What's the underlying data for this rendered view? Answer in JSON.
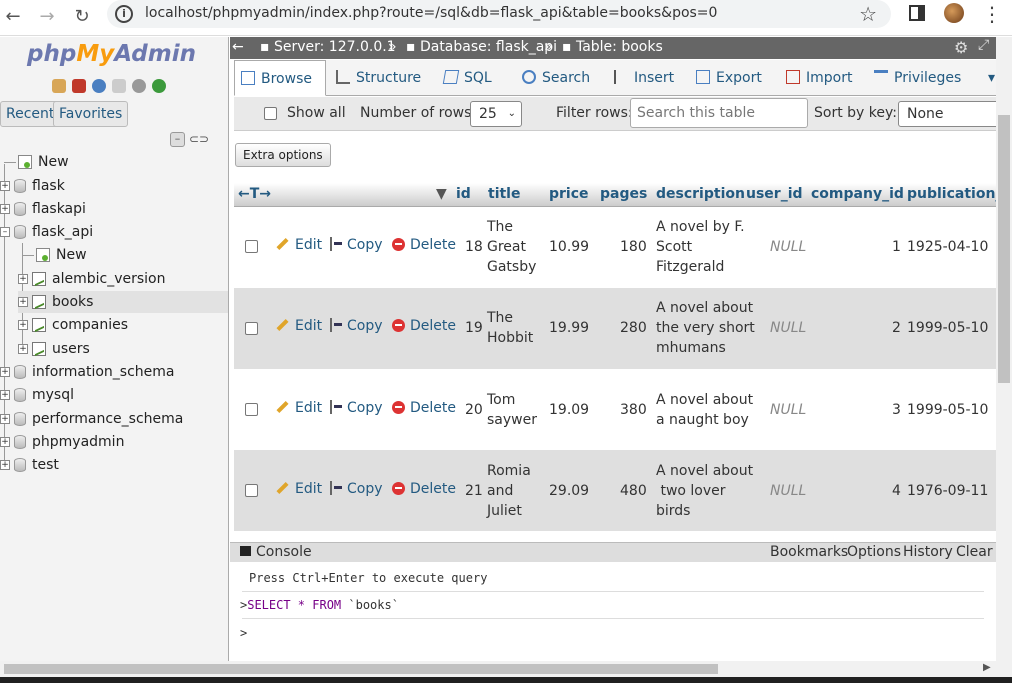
{
  "browser": {
    "url": "localhost/phpmyadmin/index.php?route=/sql&db=flask_api&table=books&pos=0",
    "back": "←",
    "forward": "→",
    "reload": "↻",
    "star": "☆",
    "menu": "⋮"
  },
  "sidebar": {
    "logo": {
      "php": "php",
      "my": "My",
      "admin": "Admin"
    },
    "tabs": {
      "recent": "Recent",
      "favorites": "Favorites"
    },
    "tree": [
      {
        "label": "New"
      },
      {
        "label": "flask"
      },
      {
        "label": "flaskapi"
      },
      {
        "label": "flask_api"
      },
      {
        "label": "New"
      },
      {
        "label": "alembic_version"
      },
      {
        "label": "books"
      },
      {
        "label": "companies"
      },
      {
        "label": "users"
      },
      {
        "label": "information_schema"
      },
      {
        "label": "mysql"
      },
      {
        "label": "performance_schema"
      },
      {
        "label": "phpmyadmin"
      },
      {
        "label": "test"
      }
    ]
  },
  "breadcrumb": {
    "server": "Server: 127.0.0.1",
    "database": "Database: flask_api",
    "table": "Table: books",
    "sep": "»"
  },
  "tabs": [
    {
      "label": "Browse"
    },
    {
      "label": "Structure"
    },
    {
      "label": "SQL"
    },
    {
      "label": "Search"
    },
    {
      "label": "Insert"
    },
    {
      "label": "Export"
    },
    {
      "label": "Import"
    },
    {
      "label": "Privileges"
    }
  ],
  "controls": {
    "show_all": "Show all",
    "rows_label": "Number of rows:",
    "rows_value": "25",
    "filter_label": "Filter rows:",
    "filter_placeholder": "Search this table",
    "sort_label": "Sort by key:",
    "sort_value": "None",
    "extra_options": "Extra options"
  },
  "columns": [
    "id",
    "title",
    "price",
    "pages",
    "description",
    "user_id",
    "company_id",
    "publication_da"
  ],
  "actions": {
    "edit": "Edit",
    "copy": "Copy",
    "delete": "Delete"
  },
  "rows": [
    {
      "id": "18",
      "title": [
        "The",
        "Great",
        "Gatsby"
      ],
      "price": "10.99",
      "pages": "180",
      "description": [
        "A novel by F.",
        "Scott",
        "Fitzgerald"
      ],
      "user_id": "NULL",
      "company_id": "1",
      "publication_date": "1925-04-10"
    },
    {
      "id": "19",
      "title": [
        "The",
        "Hobbit"
      ],
      "price": "19.99",
      "pages": "280",
      "description": [
        "A novel about",
        "the very short",
        "mhumans"
      ],
      "user_id": "NULL",
      "company_id": "2",
      "publication_date": "1999-05-10"
    },
    {
      "id": "20",
      "title": [
        "Tom",
        "saywer"
      ],
      "price": "19.09",
      "pages": "380",
      "description": [
        "A novel about",
        "a naught boy"
      ],
      "user_id": "NULL",
      "company_id": "3",
      "publication_date": "1999-05-10"
    },
    {
      "id": "21",
      "title": [
        "Romia",
        "and",
        "Juliet"
      ],
      "price": "29.09",
      "pages": "480",
      "description": [
        "A novel about",
        " two lover",
        "birds"
      ],
      "user_id": "NULL",
      "company_id": "4",
      "publication_date": "1976-09-11"
    }
  ],
  "console": {
    "title": "Console",
    "bookmarks": "Bookmarks",
    "options": "Options",
    "history": "History",
    "clear": "Clear",
    "hint": "Press Ctrl+Enter to execute query",
    "query_prefix": ">",
    "query_kw": "SELECT * FROM",
    "query_table": " `books`",
    "prompt": ">"
  }
}
